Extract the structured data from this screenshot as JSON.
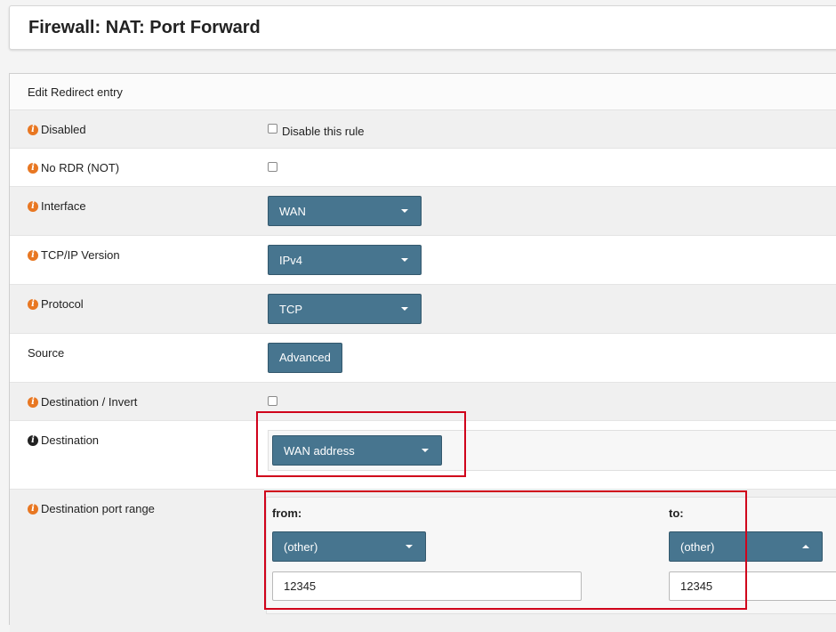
{
  "page": {
    "title": "Firewall: NAT: Port Forward"
  },
  "panel": {
    "heading": "Edit Redirect entry"
  },
  "rows": {
    "disabled": {
      "label": "Disabled",
      "checkbox_text": "Disable this rule"
    },
    "no_rdr": {
      "label": "No RDR (NOT)"
    },
    "interface": {
      "label": "Interface",
      "value": "WAN"
    },
    "tcpip_version": {
      "label": "TCP/IP Version",
      "value": "IPv4"
    },
    "protocol": {
      "label": "Protocol",
      "value": "TCP"
    },
    "source": {
      "label": "Source",
      "button": "Advanced"
    },
    "destination_invert": {
      "label": "Destination / Invert"
    },
    "destination": {
      "label": "Destination",
      "value": "WAN address"
    },
    "dest_port_range": {
      "label": "Destination port range",
      "from_label": "from:",
      "to_label": "to:",
      "from_select": "(other)",
      "to_select": "(other)",
      "from_value": "12345",
      "to_value": "12345"
    }
  },
  "colors": {
    "select_bg": "#47758f",
    "info_icon": "#e87722",
    "highlight": "#d0021b"
  }
}
